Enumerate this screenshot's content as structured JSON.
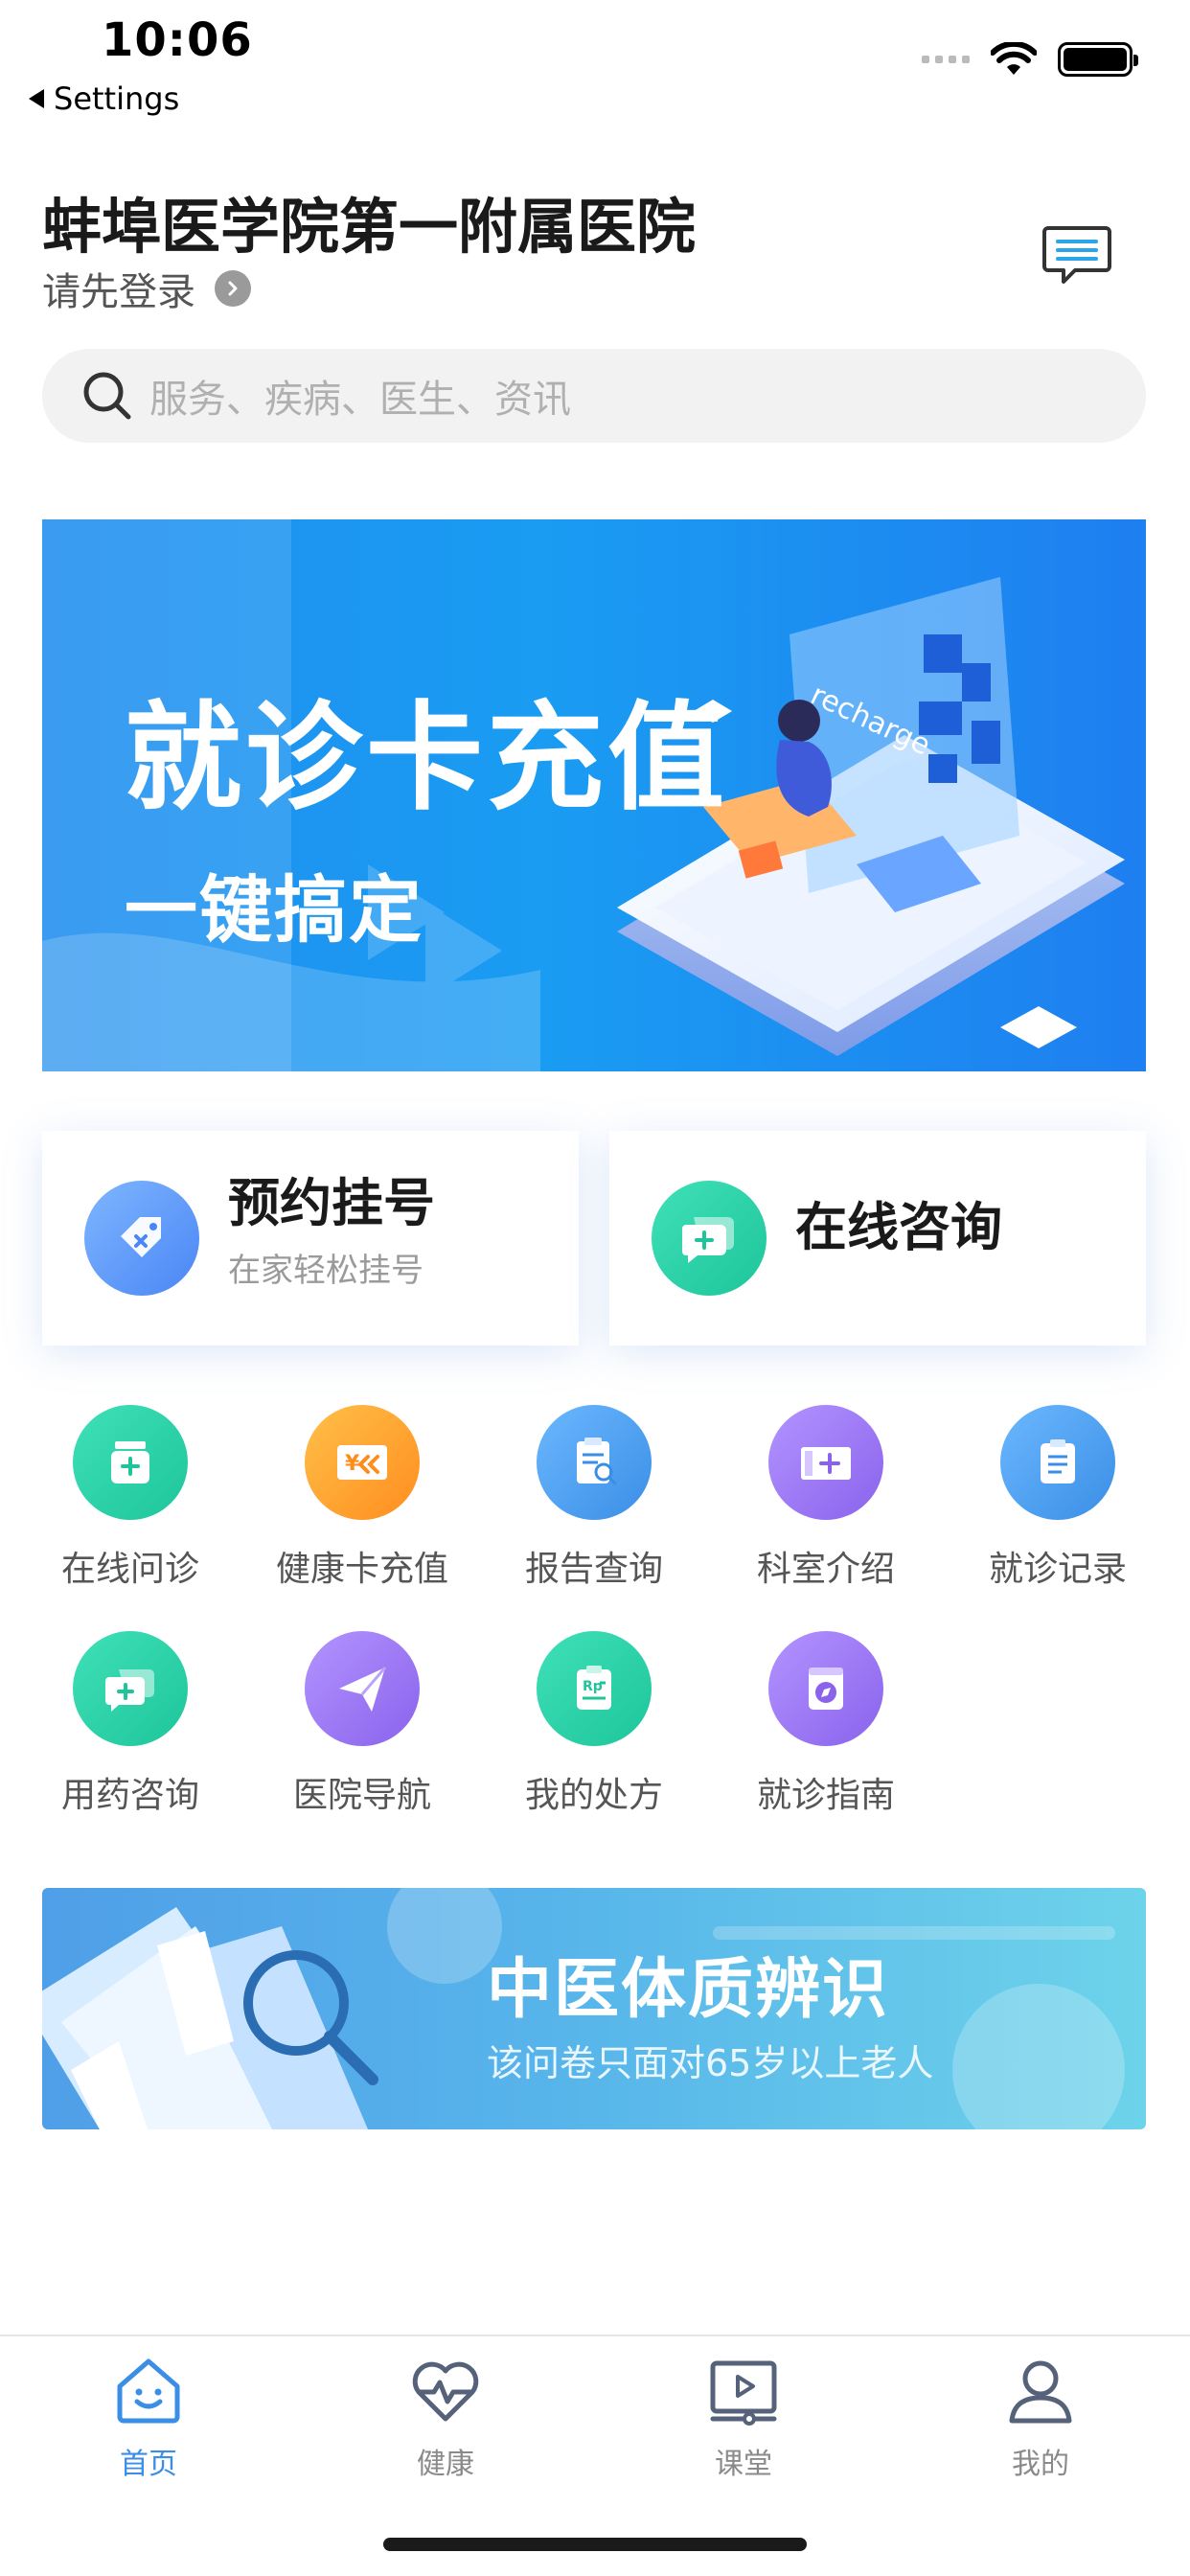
{
  "status_bar": {
    "time": "10:06",
    "back_label": "Settings"
  },
  "header": {
    "title": "蚌埠医学院第一附属医院",
    "login_prompt": "请先登录"
  },
  "search": {
    "placeholder": "服务、疾病、医生、资讯"
  },
  "banner": {
    "title": "就诊卡充值",
    "subtitle": "一键搞定",
    "art_text": "recharge"
  },
  "quick_cards": [
    {
      "title": "预约挂号",
      "subtitle": "在家轻松挂号"
    },
    {
      "title": "在线咨询",
      "subtitle": ""
    }
  ],
  "grid": [
    {
      "label": "在线问诊",
      "icon": "medicine-bottle-icon",
      "color": "#2ad3a8"
    },
    {
      "label": "健康卡充值",
      "icon": "card-recharge-icon",
      "color": "#ff9f2e"
    },
    {
      "label": "报告查询",
      "icon": "report-search-icon",
      "color": "#4aa2f5"
    },
    {
      "label": "科室介绍",
      "icon": "department-icon",
      "color": "#9b78f0"
    },
    {
      "label": "就诊记录",
      "icon": "clipboard-icon",
      "color": "#4aa2f5"
    },
    {
      "label": "用药咨询",
      "icon": "chat-plus-icon",
      "color": "#2ad3a8"
    },
    {
      "label": "医院导航",
      "icon": "paper-plane-icon",
      "color": "#9b78f0"
    },
    {
      "label": "我的处方",
      "icon": "prescription-icon",
      "color": "#2ad3a8"
    },
    {
      "label": "就诊指南",
      "icon": "compass-guide-icon",
      "color": "#9b78f0"
    }
  ],
  "tcm_banner": {
    "title": "中医体质辨识",
    "subtitle": "该问卷只面对65岁以上老人"
  },
  "tabs": [
    {
      "label": "首页",
      "icon": "home-smile-icon",
      "active": true
    },
    {
      "label": "健康",
      "icon": "heart-pulse-icon",
      "active": false
    },
    {
      "label": "课堂",
      "icon": "video-class-icon",
      "active": false
    },
    {
      "label": "我的",
      "icon": "profile-icon",
      "active": false
    }
  ],
  "colors": {
    "accent": "#3a8ee6",
    "green": "#2ad3a8",
    "orange": "#ff9f2e",
    "blue": "#4aa2f5",
    "purple": "#9b78f0"
  }
}
